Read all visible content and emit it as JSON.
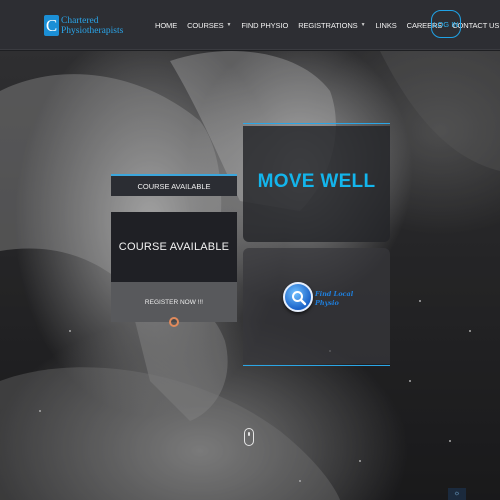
{
  "header": {
    "logo": {
      "mark": "C",
      "line1": "Chartered",
      "line2": "Physiotherapists"
    },
    "nav": [
      {
        "label": "HOME",
        "dropdown": false
      },
      {
        "label": "COURSES",
        "dropdown": true
      },
      {
        "label": "FIND PHYSIO",
        "dropdown": false
      },
      {
        "label": "REGISTRATIONS",
        "dropdown": true
      },
      {
        "label": "LINKS",
        "dropdown": false
      },
      {
        "label": "CAREERS",
        "dropdown": false
      },
      {
        "label": "CONTACT US",
        "dropdown": false
      }
    ],
    "login_label": "LOG IN"
  },
  "hero": {
    "course_label": "COURSE AVAILABLE",
    "course_title": "COURSE AVAILABLE",
    "register_label": "REGISTER NOW !!!",
    "headline": "MOVE WELL",
    "find_physio": {
      "line1": "Find Local",
      "line2": "Physio"
    }
  },
  "colors": {
    "accent": "#13b5ec",
    "header_bg": "#2d2e33",
    "login_border": "#1fa2e6"
  },
  "icons": {
    "caret": "chevron-down-icon",
    "find": "search-icon",
    "scroll": "mouse-scroll-icon"
  }
}
